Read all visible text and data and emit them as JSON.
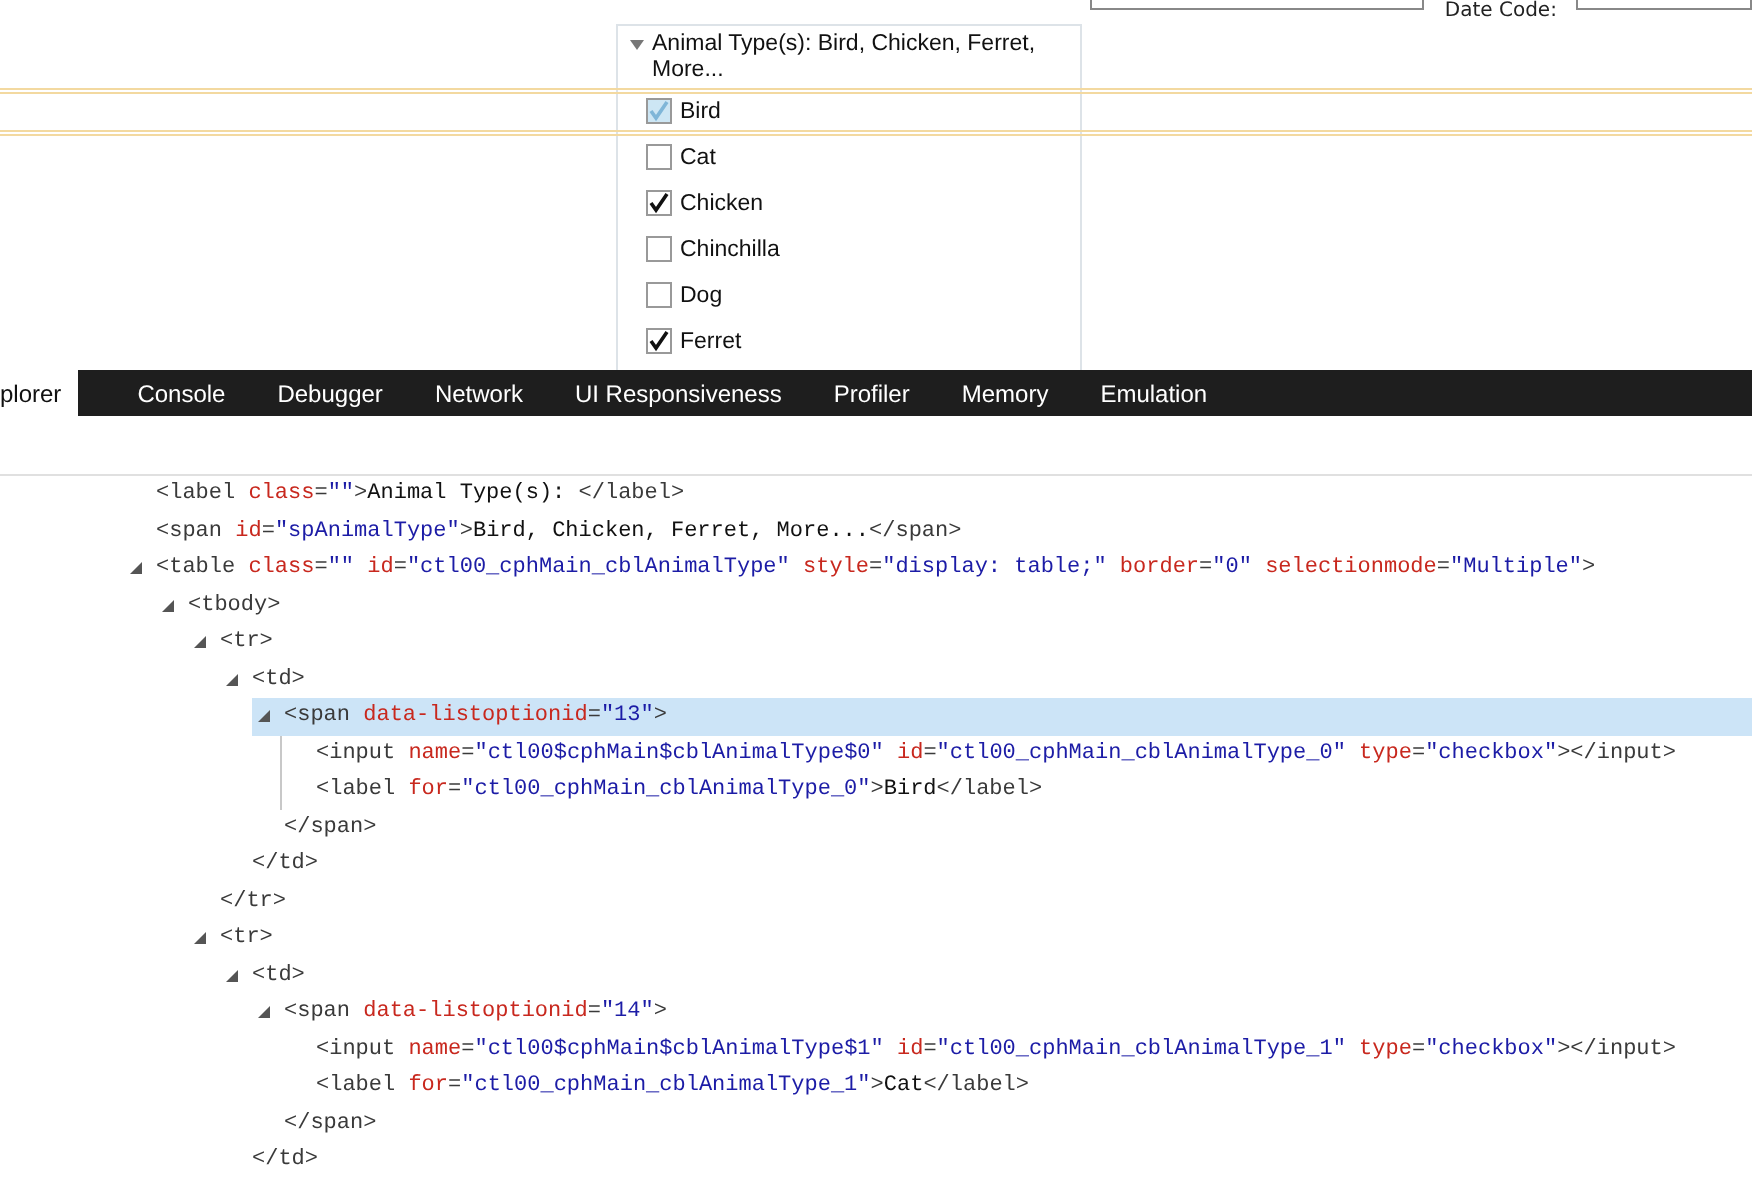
{
  "page": {
    "date_code_label": "Date Code:",
    "dropdown": {
      "header": "Animal Type(s): Bird, Chicken, Ferret, More...",
      "expanded": true,
      "options": [
        {
          "label": "Bird",
          "checked": true,
          "highlighted": true
        },
        {
          "label": "Cat",
          "checked": false,
          "highlighted": false
        },
        {
          "label": "Chicken",
          "checked": true,
          "highlighted": false
        },
        {
          "label": "Chinchilla",
          "checked": false,
          "highlighted": false
        },
        {
          "label": "Dog",
          "checked": false,
          "highlighted": false
        },
        {
          "label": "Ferret",
          "checked": true,
          "highlighted": false
        }
      ]
    }
  },
  "devtools": {
    "tabs": [
      {
        "label": "plorer",
        "selected": true
      },
      {
        "label": "Console",
        "selected": false
      },
      {
        "label": "Debugger",
        "selected": false
      },
      {
        "label": "Network",
        "selected": false
      },
      {
        "label": "UI Responsiveness",
        "selected": false
      },
      {
        "label": "Profiler",
        "selected": false
      },
      {
        "label": "Memory",
        "selected": false
      },
      {
        "label": "Emulation",
        "selected": false
      }
    ],
    "dom_tree": [
      {
        "selected": false,
        "line": [
          {
            "kind": "tag",
            "text": "<label"
          },
          {
            "kind": "attr",
            "text": " class"
          },
          {
            "kind": "tag",
            "text": "="
          },
          {
            "kind": "value",
            "text": "\"\""
          },
          {
            "kind": "tag",
            "text": ">"
          },
          {
            "kind": "text",
            "text": "Animal Type(s): "
          },
          {
            "kind": "tag",
            "text": "</label>"
          }
        ]
      },
      {
        "selected": false,
        "line": [
          {
            "kind": "tag",
            "text": "<span"
          },
          {
            "kind": "attr",
            "text": " id"
          },
          {
            "kind": "tag",
            "text": "="
          },
          {
            "kind": "value",
            "text": "\"spAnimalType\""
          },
          {
            "kind": "tag",
            "text": ">"
          },
          {
            "kind": "text",
            "text": "Bird, Chicken, Ferret, More..."
          },
          {
            "kind": "tag",
            "text": "</span>"
          }
        ]
      },
      {
        "selected": false,
        "expanded": true,
        "line": [
          {
            "kind": "tag",
            "text": "<table"
          },
          {
            "kind": "attr",
            "text": " class"
          },
          {
            "kind": "tag",
            "text": "="
          },
          {
            "kind": "value",
            "text": "\"\""
          },
          {
            "kind": "attr",
            "text": " id"
          },
          {
            "kind": "tag",
            "text": "="
          },
          {
            "kind": "value",
            "text": "\"ctl00_cphMain_cblAnimalType\""
          },
          {
            "kind": "attr",
            "text": " style"
          },
          {
            "kind": "tag",
            "text": "="
          },
          {
            "kind": "value",
            "text": "\"display: table;\""
          },
          {
            "kind": "attr",
            "text": " border"
          },
          {
            "kind": "tag",
            "text": "="
          },
          {
            "kind": "value",
            "text": "\"0\""
          },
          {
            "kind": "attr",
            "text": " selectionmode"
          },
          {
            "kind": "tag",
            "text": "="
          },
          {
            "kind": "value",
            "text": "\"Multiple\""
          },
          {
            "kind": "tag",
            "text": ">"
          }
        ],
        "children": [
          {
            "selected": false,
            "expanded": true,
            "line": [
              {
                "kind": "tag",
                "text": "<tbody>"
              }
            ],
            "children": [
              {
                "selected": false,
                "expanded": true,
                "line": [
                  {
                    "kind": "tag",
                    "text": "<tr>"
                  }
                ],
                "close": [
                  {
                    "kind": "tag",
                    "text": "</tr>"
                  }
                ],
                "children": [
                  {
                    "selected": false,
                    "expanded": true,
                    "line": [
                      {
                        "kind": "tag",
                        "text": "<td>"
                      }
                    ],
                    "close": [
                      {
                        "kind": "tag",
                        "text": "</td>"
                      }
                    ],
                    "children": [
                      {
                        "selected": true,
                        "expanded": true,
                        "line": [
                          {
                            "kind": "tag",
                            "text": "<span"
                          },
                          {
                            "kind": "attr",
                            "text": " data-listoptionid"
                          },
                          {
                            "kind": "tag",
                            "text": "="
                          },
                          {
                            "kind": "value",
                            "text": "\"13\""
                          },
                          {
                            "kind": "tag",
                            "text": ">"
                          }
                        ],
                        "close": [
                          {
                            "kind": "tag",
                            "text": "</span>"
                          }
                        ],
                        "children": [
                          {
                            "selected": false,
                            "line": [
                              {
                                "kind": "tag",
                                "text": "<input"
                              },
                              {
                                "kind": "attr",
                                "text": " name"
                              },
                              {
                                "kind": "tag",
                                "text": "="
                              },
                              {
                                "kind": "value",
                                "text": "\"ctl00$cphMain$cblAnimalType$0\""
                              },
                              {
                                "kind": "attr",
                                "text": " id"
                              },
                              {
                                "kind": "tag",
                                "text": "="
                              },
                              {
                                "kind": "value",
                                "text": "\"ctl00_cphMain_cblAnimalType_0\""
                              },
                              {
                                "kind": "attr",
                                "text": " type"
                              },
                              {
                                "kind": "tag",
                                "text": "="
                              },
                              {
                                "kind": "value",
                                "text": "\"checkbox\""
                              },
                              {
                                "kind": "tag",
                                "text": "></input>"
                              }
                            ]
                          },
                          {
                            "selected": false,
                            "line": [
                              {
                                "kind": "tag",
                                "text": "<label"
                              },
                              {
                                "kind": "attr",
                                "text": " for"
                              },
                              {
                                "kind": "tag",
                                "text": "="
                              },
                              {
                                "kind": "value",
                                "text": "\"ctl00_cphMain_cblAnimalType_0\""
                              },
                              {
                                "kind": "tag",
                                "text": ">"
                              },
                              {
                                "kind": "text",
                                "text": "Bird"
                              },
                              {
                                "kind": "tag",
                                "text": "</label>"
                              }
                            ]
                          }
                        ]
                      }
                    ]
                  }
                ]
              },
              {
                "selected": false,
                "expanded": true,
                "line": [
                  {
                    "kind": "tag",
                    "text": "<tr>"
                  }
                ],
                "children": [
                  {
                    "selected": false,
                    "expanded": true,
                    "line": [
                      {
                        "kind": "tag",
                        "text": "<td>"
                      }
                    ],
                    "close": [
                      {
                        "kind": "tag",
                        "text": "</td>"
                      }
                    ],
                    "children": [
                      {
                        "selected": false,
                        "expanded": true,
                        "line": [
                          {
                            "kind": "tag",
                            "text": "<span"
                          },
                          {
                            "kind": "attr",
                            "text": " data-listoptionid"
                          },
                          {
                            "kind": "tag",
                            "text": "="
                          },
                          {
                            "kind": "value",
                            "text": "\"14\""
                          },
                          {
                            "kind": "tag",
                            "text": ">"
                          }
                        ],
                        "close": [
                          {
                            "kind": "tag",
                            "text": "</span>"
                          }
                        ],
                        "children": [
                          {
                            "selected": false,
                            "line": [
                              {
                                "kind": "tag",
                                "text": "<input"
                              },
                              {
                                "kind": "attr",
                                "text": " name"
                              },
                              {
                                "kind": "tag",
                                "text": "="
                              },
                              {
                                "kind": "value",
                                "text": "\"ctl00$cphMain$cblAnimalType$1\""
                              },
                              {
                                "kind": "attr",
                                "text": " id"
                              },
                              {
                                "kind": "tag",
                                "text": "="
                              },
                              {
                                "kind": "value",
                                "text": "\"ctl00_cphMain_cblAnimalType_1\""
                              },
                              {
                                "kind": "attr",
                                "text": " type"
                              },
                              {
                                "kind": "tag",
                                "text": "="
                              },
                              {
                                "kind": "value",
                                "text": "\"checkbox\""
                              },
                              {
                                "kind": "tag",
                                "text": "></input>"
                              }
                            ]
                          },
                          {
                            "selected": false,
                            "line": [
                              {
                                "kind": "tag",
                                "text": "<label"
                              },
                              {
                                "kind": "attr",
                                "text": " for"
                              },
                              {
                                "kind": "tag",
                                "text": "="
                              },
                              {
                                "kind": "value",
                                "text": "\"ctl00_cphMain_cblAnimalType_1\""
                              },
                              {
                                "kind": "tag",
                                "text": ">"
                              },
                              {
                                "kind": "text",
                                "text": "Cat"
                              },
                              {
                                "kind": "tag",
                                "text": "</label>"
                              }
                            ]
                          }
                        ]
                      }
                    ]
                  }
                ]
              }
            ]
          }
        ]
      }
    ]
  }
}
